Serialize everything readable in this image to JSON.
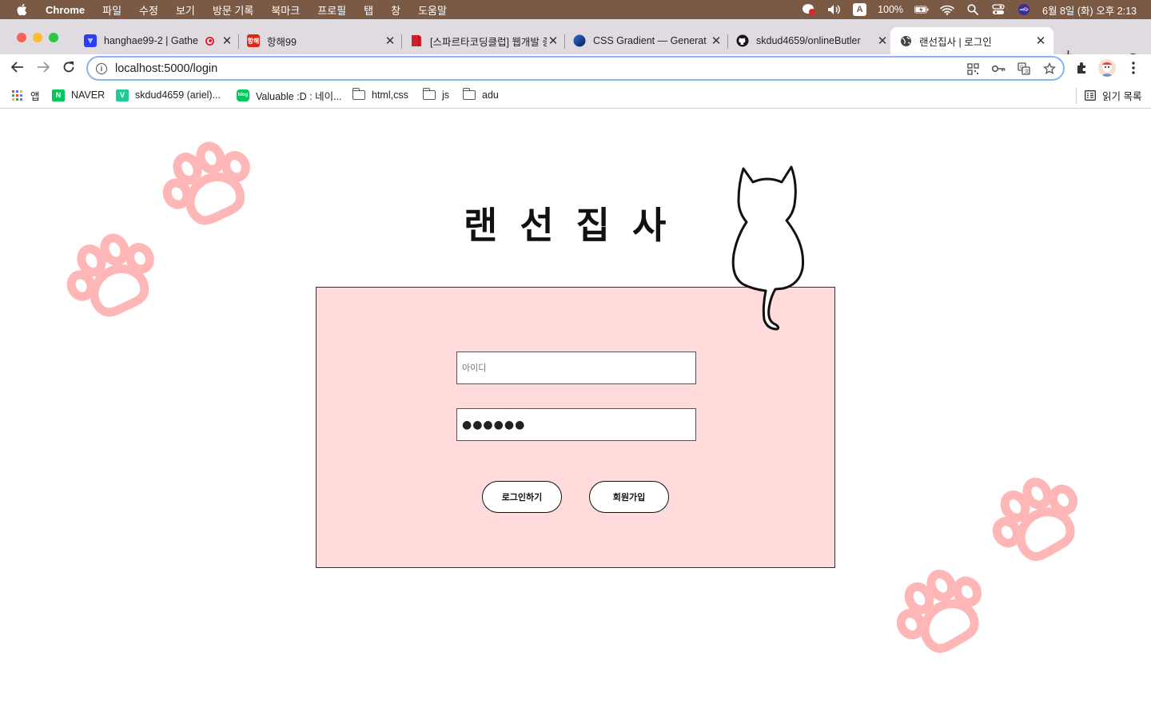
{
  "menubar": {
    "app": "Chrome",
    "items": [
      "파일",
      "수정",
      "보기",
      "방문 기록",
      "북마크",
      "프로필",
      "탭",
      "창",
      "도움말"
    ],
    "battery": "100%",
    "input_source": "A",
    "datetime": "6월 8일 (화) 오후 2:13"
  },
  "tabs": [
    {
      "title": "hanghae99-2 | Gathe",
      "favicon_color": "#2d3df5",
      "favicon_text": "",
      "recording": true
    },
    {
      "title": "항해99",
      "favicon_color": "#e2231a",
      "favicon_text": "항해"
    },
    {
      "title": "[스파르타코딩클럽] 웹개발 종",
      "favicon_color": "#d0212b",
      "favicon_text": ""
    },
    {
      "title": "CSS Gradient — Generat",
      "favicon_color": "#1b3d8f",
      "favicon_text": ""
    },
    {
      "title": "skdud4659/onlineButler",
      "favicon_color": "#181717",
      "favicon_text": ""
    },
    {
      "title": "랜선집사 | 로그인",
      "favicon_color": "#444444",
      "favicon_text": "",
      "active": true
    }
  ],
  "toolbar": {
    "url": "localhost:5000/login",
    "icons": [
      "qr-icon",
      "key-icon",
      "translate-icon",
      "star-icon",
      "extensions-icon",
      "profile-icon",
      "menu-icon"
    ]
  },
  "bookmarks": {
    "apps": "앱",
    "items": [
      {
        "label": "NAVER",
        "icon": "naver",
        "color": "#03c75a",
        "text": "N"
      },
      {
        "label": "skdud4659 (ariel)...",
        "icon": "velog",
        "color": "#20c997",
        "text": "V"
      },
      {
        "label": "Valuable :D : 네이...",
        "icon": "blog",
        "color": "#03c75a",
        "text": "blog"
      },
      {
        "label": "html,css",
        "icon": "folder"
      },
      {
        "label": "js",
        "icon": "folder"
      },
      {
        "label": "adu",
        "icon": "folder"
      }
    ],
    "reading_list": "읽기 목록"
  },
  "page": {
    "title": "랜선집사",
    "id_placeholder": "아이디",
    "password_value": "●●●●●●",
    "login_button": "로그인하기",
    "signup_button": "회원가입",
    "box_color": "#ffdbdb",
    "paw_color": "#ffb6b6"
  }
}
